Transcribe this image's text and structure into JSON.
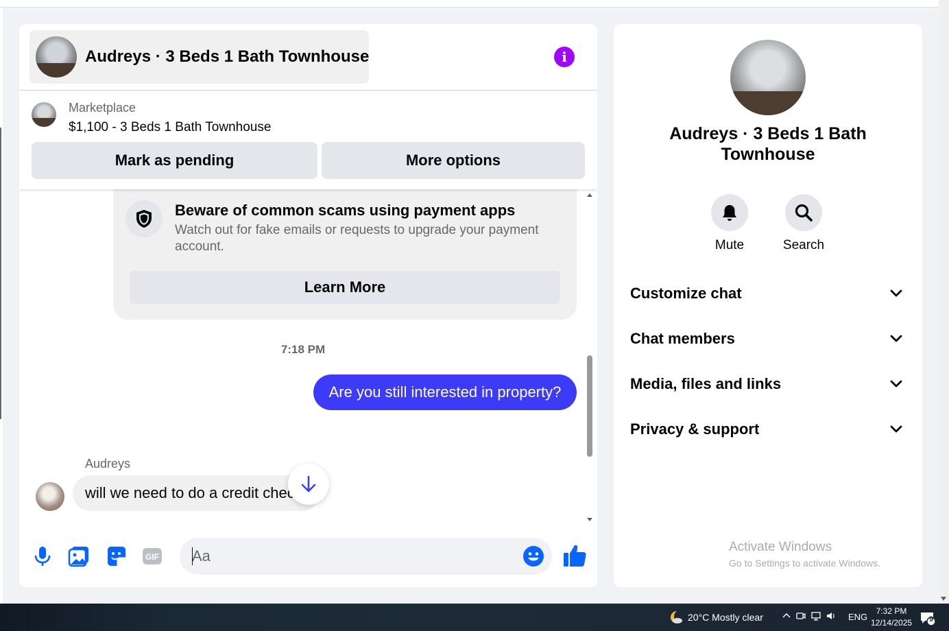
{
  "conversation": {
    "title": "Audreys · 3 Beds 1 Bath Townhouse"
  },
  "listing": {
    "source": "Marketplace",
    "price_title": "$1,100 - 3 Beds 1 Bath Townhouse",
    "mark_pending_label": "Mark as pending",
    "more_options_label": "More options"
  },
  "scam_notice": {
    "title": "Beware of common scams using payment apps",
    "body": "Watch out for fake emails or requests to upgrade your payment account.",
    "learn_more_label": "Learn More"
  },
  "messages": {
    "timestamp": "7:18 PM",
    "outgoing": "Are you still interested in property?",
    "incoming_sender": "Audreys",
    "incoming": "will we need to do a credit check"
  },
  "composer": {
    "placeholder": "Aa"
  },
  "info_panel": {
    "name": "Audreys · 3 Beds 1 Bath Townhouse",
    "mute_label": "Mute",
    "search_label": "Search",
    "sections": [
      "Customize chat",
      "Chat members",
      "Media, files and links",
      "Privacy & support"
    ]
  },
  "watermark": {
    "line1": "Activate Windows",
    "line2": "Go to Settings to activate Windows."
  },
  "taskbar": {
    "weather": "20°C  Mostly clear",
    "language": "ENG",
    "time": "7:32 PM",
    "date": "12/14/2025",
    "notification_count": "9"
  },
  "colors": {
    "accent": "#3c3cf8",
    "messenger_blue": "#0866ff",
    "info_purple": "#a005ff"
  }
}
